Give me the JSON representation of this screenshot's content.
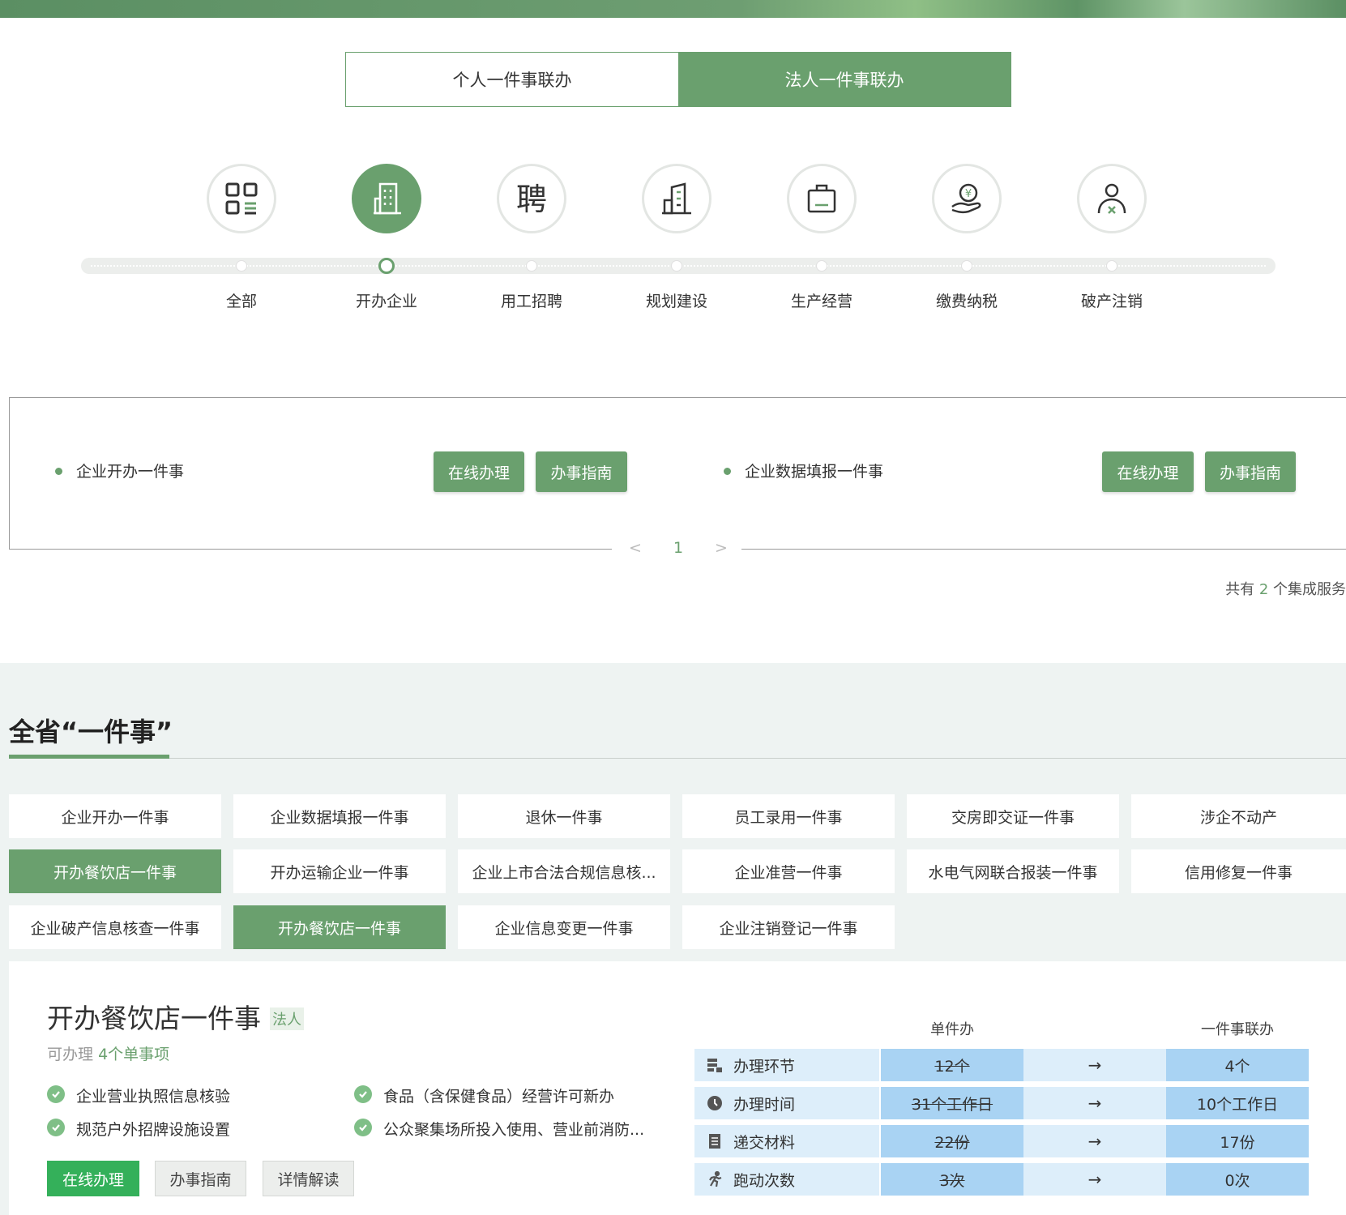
{
  "tabs": [
    {
      "label": "个人一件事联办",
      "active": false
    },
    {
      "label": "法人一件事联办",
      "active": true
    }
  ],
  "categories": [
    {
      "label": "全部",
      "icon": "grid-apps-icon",
      "active": false
    },
    {
      "label": "开办企业",
      "icon": "building-icon",
      "active": true
    },
    {
      "label": "用工招聘",
      "icon": "hire-character-icon",
      "active": false
    },
    {
      "label": "规划建设",
      "icon": "construction-building-icon",
      "active": false
    },
    {
      "label": "生产经营",
      "icon": "briefcase-icon",
      "active": false
    },
    {
      "label": "缴费纳税",
      "icon": "yuan-hand-icon",
      "active": false
    },
    {
      "label": "破产注销",
      "icon": "person-cancel-icon",
      "active": false
    }
  ],
  "services": [
    {
      "title": "企业开办一件事",
      "online_label": "在线办理",
      "guide_label": "办事指南"
    },
    {
      "title": "企业数据填报一件事",
      "online_label": "在线办理",
      "guide_label": "办事指南"
    }
  ],
  "pager": {
    "prev": "<",
    "current": "1",
    "next": ">"
  },
  "total": {
    "prefix": "共有",
    "count": "2",
    "suffix": "个集成服务"
  },
  "section": {
    "title": "全省“一件事”"
  },
  "grid_items": [
    {
      "label": "企业开办一件事",
      "active": false
    },
    {
      "label": "企业数据填报一件事",
      "active": false
    },
    {
      "label": "退休一件事",
      "active": false
    },
    {
      "label": "员工录用一件事",
      "active": false
    },
    {
      "label": "交房即交证一件事",
      "active": false
    },
    {
      "label": "涉企不动产",
      "active": false
    },
    {
      "label": "开办餐饮店一件事",
      "active": true
    },
    {
      "label": "开办运输企业一件事",
      "active": false
    },
    {
      "label": "企业上市合法合规信息核...",
      "active": false
    },
    {
      "label": "企业准营一件事",
      "active": false
    },
    {
      "label": "水电气网联合报装一件事",
      "active": false
    },
    {
      "label": "信用修复一件事",
      "active": false
    },
    {
      "label": "企业破产信息核查一件事",
      "active": false
    },
    {
      "label": "开办餐饮店一件事",
      "active": true
    },
    {
      "label": "企业信息变更一件事",
      "active": false
    },
    {
      "label": "企业注销登记一件事",
      "active": false
    }
  ],
  "detail": {
    "title": "开办餐饮店一件事",
    "tag": "法人",
    "sub_prefix": "可办理",
    "sub_count": "4个单事项",
    "items": [
      "企业营业执照信息核验",
      "食品（含保健食品）经营许可新办",
      "规范户外招牌设施设置",
      "公众聚集场所投入使用、营业前消防..."
    ],
    "buttons": {
      "online": "在线办理",
      "guide": "办事指南",
      "detail": "详情解读"
    }
  },
  "compare": {
    "header_single": "单件办",
    "header_joint": "一件事联办",
    "arrow": "→",
    "rows": [
      {
        "label": "办理环节",
        "icon": "steps-icon",
        "old": "12个",
        "new": "4个"
      },
      {
        "label": "办理时间",
        "icon": "clock-icon",
        "old": "31个工作日",
        "new": "10个工作日"
      },
      {
        "label": "递交材料",
        "icon": "document-icon",
        "old": "22份",
        "new": "17份"
      },
      {
        "label": "跑动次数",
        "icon": "running-icon",
        "old": "3次",
        "new": "0次"
      }
    ]
  },
  "colors": {
    "primary": "#6aa06e",
    "check": "#7fbf87",
    "online_btn": "#34b05a",
    "table_cell": "#a9d3f3",
    "table_row": "#ddeefa"
  }
}
